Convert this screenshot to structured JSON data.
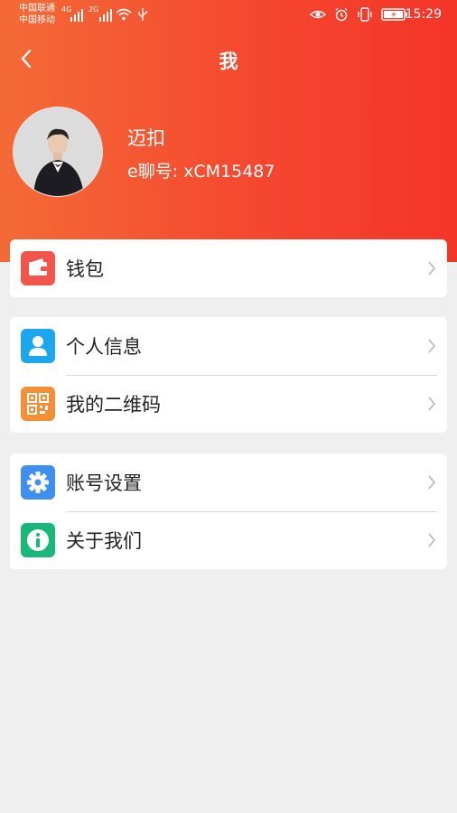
{
  "status": {
    "carrier1": "中国联通",
    "carrier2": "中国移动",
    "net1": "4G",
    "net2": "2G",
    "time": "15:29"
  },
  "nav": {
    "title": "我",
    "back_icon": "back-arrow-icon"
  },
  "profile": {
    "name": "迈扣",
    "eid": "e聊号: xCM15487"
  },
  "menu": {
    "wallet": {
      "label": "钱包",
      "icon": "wallet-icon",
      "color": "#f2564a"
    },
    "personal": {
      "label": "个人信息",
      "icon": "person-icon",
      "color": "#1ba6ee"
    },
    "qr": {
      "label": "我的二维码",
      "icon": "qr-code-icon",
      "color": "#f39036"
    },
    "settings": {
      "label": "账号设置",
      "icon": "gear-icon",
      "color": "#3f8ff0"
    },
    "about": {
      "label": "关于我们",
      "icon": "info-icon",
      "color": "#19b77a"
    }
  },
  "colors": {
    "header_start": "#f46a36",
    "header_end": "#f43528",
    "background": "#efefef"
  }
}
